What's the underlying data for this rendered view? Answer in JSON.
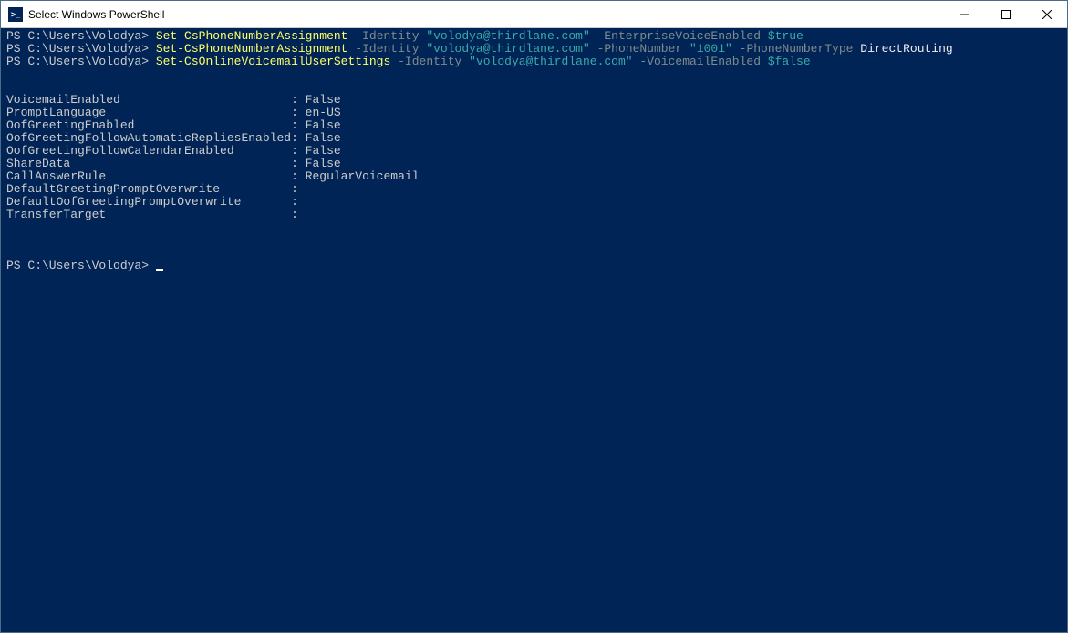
{
  "window": {
    "title": "Select Windows PowerShell"
  },
  "terminal": {
    "prompt": "PS C:\\Users\\Volodya>",
    "commands": [
      {
        "cmd": "Set-CsPhoneNumberAssignment",
        "args": [
          {
            "param": "-Identity",
            "value": "\"volodya@thirdlane.com\"",
            "valueType": "string"
          },
          {
            "param": "-EnterpriseVoiceEnabled",
            "value": "$true",
            "valueType": "bool"
          }
        ]
      },
      {
        "cmd": "Set-CsPhoneNumberAssignment",
        "args": [
          {
            "param": "-Identity",
            "value": "\"volodya@thirdlane.com\"",
            "valueType": "string"
          },
          {
            "param": "-PhoneNumber",
            "value": "\"1001\"",
            "valueType": "string"
          },
          {
            "param": "-PhoneNumberType",
            "value": "DirectRouting",
            "valueType": "white"
          }
        ]
      },
      {
        "cmd": "Set-CsOnlineVoicemailUserSettings",
        "args": [
          {
            "param": "-Identity",
            "value": "\"volodya@thirdlane.com\"",
            "valueType": "string"
          },
          {
            "param": "-VoicemailEnabled",
            "value": "$false",
            "valueType": "bool"
          }
        ]
      }
    ],
    "output": [
      {
        "key": "VoicemailEnabled",
        "value": "False"
      },
      {
        "key": "PromptLanguage",
        "value": "en-US"
      },
      {
        "key": "OofGreetingEnabled",
        "value": "False"
      },
      {
        "key": "OofGreetingFollowAutomaticRepliesEnabled",
        "value": "False"
      },
      {
        "key": "OofGreetingFollowCalendarEnabled",
        "value": "False"
      },
      {
        "key": "ShareData",
        "value": "False"
      },
      {
        "key": "CallAnswerRule",
        "value": "RegularVoicemail"
      },
      {
        "key": "DefaultGreetingPromptOverwrite",
        "value": ""
      },
      {
        "key": "DefaultOofGreetingPromptOverwrite",
        "value": ""
      },
      {
        "key": "TransferTarget",
        "value": ""
      }
    ],
    "keyColWidth": 40
  }
}
